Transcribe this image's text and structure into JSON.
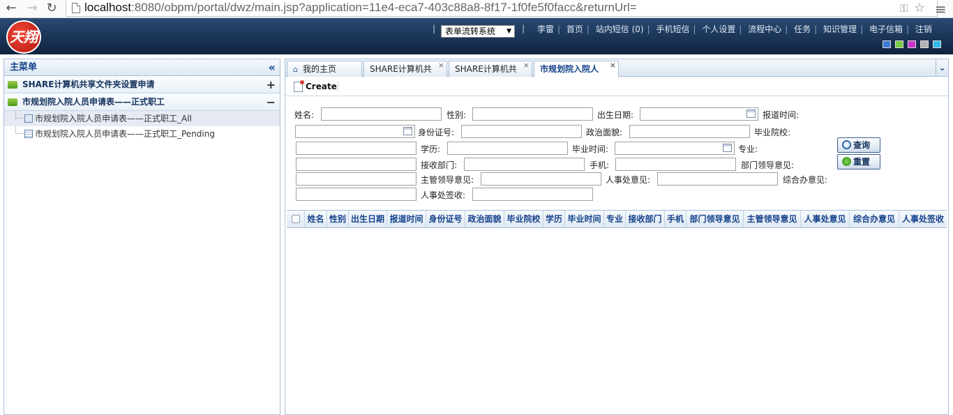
{
  "browser": {
    "url_host": "localhost",
    "url_rest": ":8080/obpm/portal/dwz/main.jsp?application=11e4-eca7-403c88a8-8f17-1f0fe5f0facc&returnUrl="
  },
  "header": {
    "logo_text": "天翔",
    "system_select": "表单流转系统",
    "nav": [
      "李雷",
      "首页",
      "站内短信 (0)",
      "手机短信",
      "个人设置",
      "流程中心",
      "任务",
      "知识管理",
      "电子信箱",
      "注销"
    ],
    "theme_colors": [
      "#3d7bd6",
      "#7ac943",
      "#cc33cc",
      "#b3b3b3",
      "#33bbee"
    ]
  },
  "sidebar": {
    "title": "主菜单",
    "groups": [
      {
        "label": "SHARE计算机共享文件夹设置申请",
        "toggle": "+"
      },
      {
        "label": "市规划院入院人员申请表——正式职工",
        "toggle": "−"
      }
    ],
    "items": [
      {
        "label": "市规划院入院人员申请表——正式职工_All"
      },
      {
        "label": "市规划院入院人员申请表——正式职工_Pending"
      }
    ]
  },
  "tabs": [
    {
      "label": "我的主页"
    },
    {
      "label": "SHARE计算机共"
    },
    {
      "label": "SHARE计算机共"
    },
    {
      "label": "市规划院入院人"
    }
  ],
  "toolbar": {
    "create_label": "Create"
  },
  "form": {
    "labels": {
      "name": "姓名:",
      "gender": "性别:",
      "birth": "出生日期:",
      "report_time": "报道时间:",
      "id_no": "身份证号:",
      "political": "政治面貌:",
      "school": "毕业院校:",
      "education": "学历:",
      "grad_time": "毕业时间:",
      "major": "专业:",
      "dept": "接收部门:",
      "mobile": "手机:",
      "dept_leader": "部门领导意见:",
      "chief_leader": "主管领导意见:",
      "hr_opinion": "人事处意见:",
      "general_opinion": "综合办意见:",
      "hr_sign": "人事处签收:"
    },
    "query_label": "查询",
    "reset_label": "重置"
  },
  "grid": {
    "columns": [
      "姓名",
      "性别",
      "出生日期",
      "报道时间",
      "身份证号",
      "政治面貌",
      "毕业院校",
      "学历",
      "毕业时间",
      "专业",
      "接收部门",
      "手机",
      "部门领导意见",
      "主管领导意见",
      "人事处意见",
      "综合办意见",
      "人事处签收"
    ]
  }
}
